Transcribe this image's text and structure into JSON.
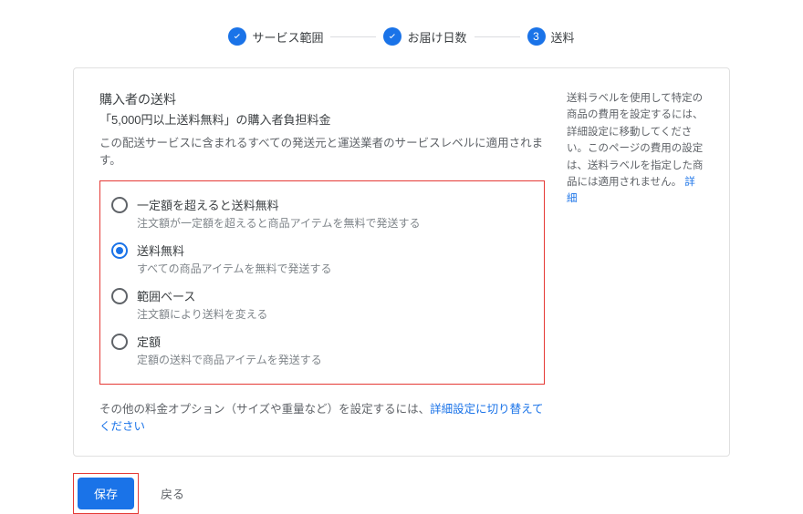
{
  "stepper": {
    "steps": [
      {
        "label": "サービス範囲",
        "state": "done"
      },
      {
        "label": "お届け日数",
        "state": "done"
      },
      {
        "label": "送料",
        "state": "current",
        "number": "3"
      }
    ]
  },
  "main": {
    "title": "購入者の送料",
    "subtitle": "「5,000円以上送料無料」の購入者負担料金",
    "description": "この配送サービスに含まれるすべての発送元と運送業者のサービスレベルに適用されます。",
    "radios": [
      {
        "title": "一定額を超えると送料無料",
        "desc": "注文額が一定額を超えると商品アイテムを無料で発送する",
        "selected": false
      },
      {
        "title": "送料無料",
        "desc": "すべての商品アイテムを無料で発送する",
        "selected": true
      },
      {
        "title": "範囲ベース",
        "desc": "注文額により送料を変える",
        "selected": false
      },
      {
        "title": "定額",
        "desc": "定額の送料で商品アイテムを発送する",
        "selected": false
      }
    ],
    "other_prefix": "その他の料金オプション（サイズや重量など）を設定するには、",
    "other_link": "詳細設定に切り替えてください"
  },
  "side": {
    "text": "送料ラベルを使用して特定の商品の費用を設定するには、詳細設定に移動してください。このページの費用の設定は、送料ラベルを指定した商品には適用されません。",
    "link": "詳細"
  },
  "actions": {
    "save": "保存",
    "back": "戻る"
  }
}
